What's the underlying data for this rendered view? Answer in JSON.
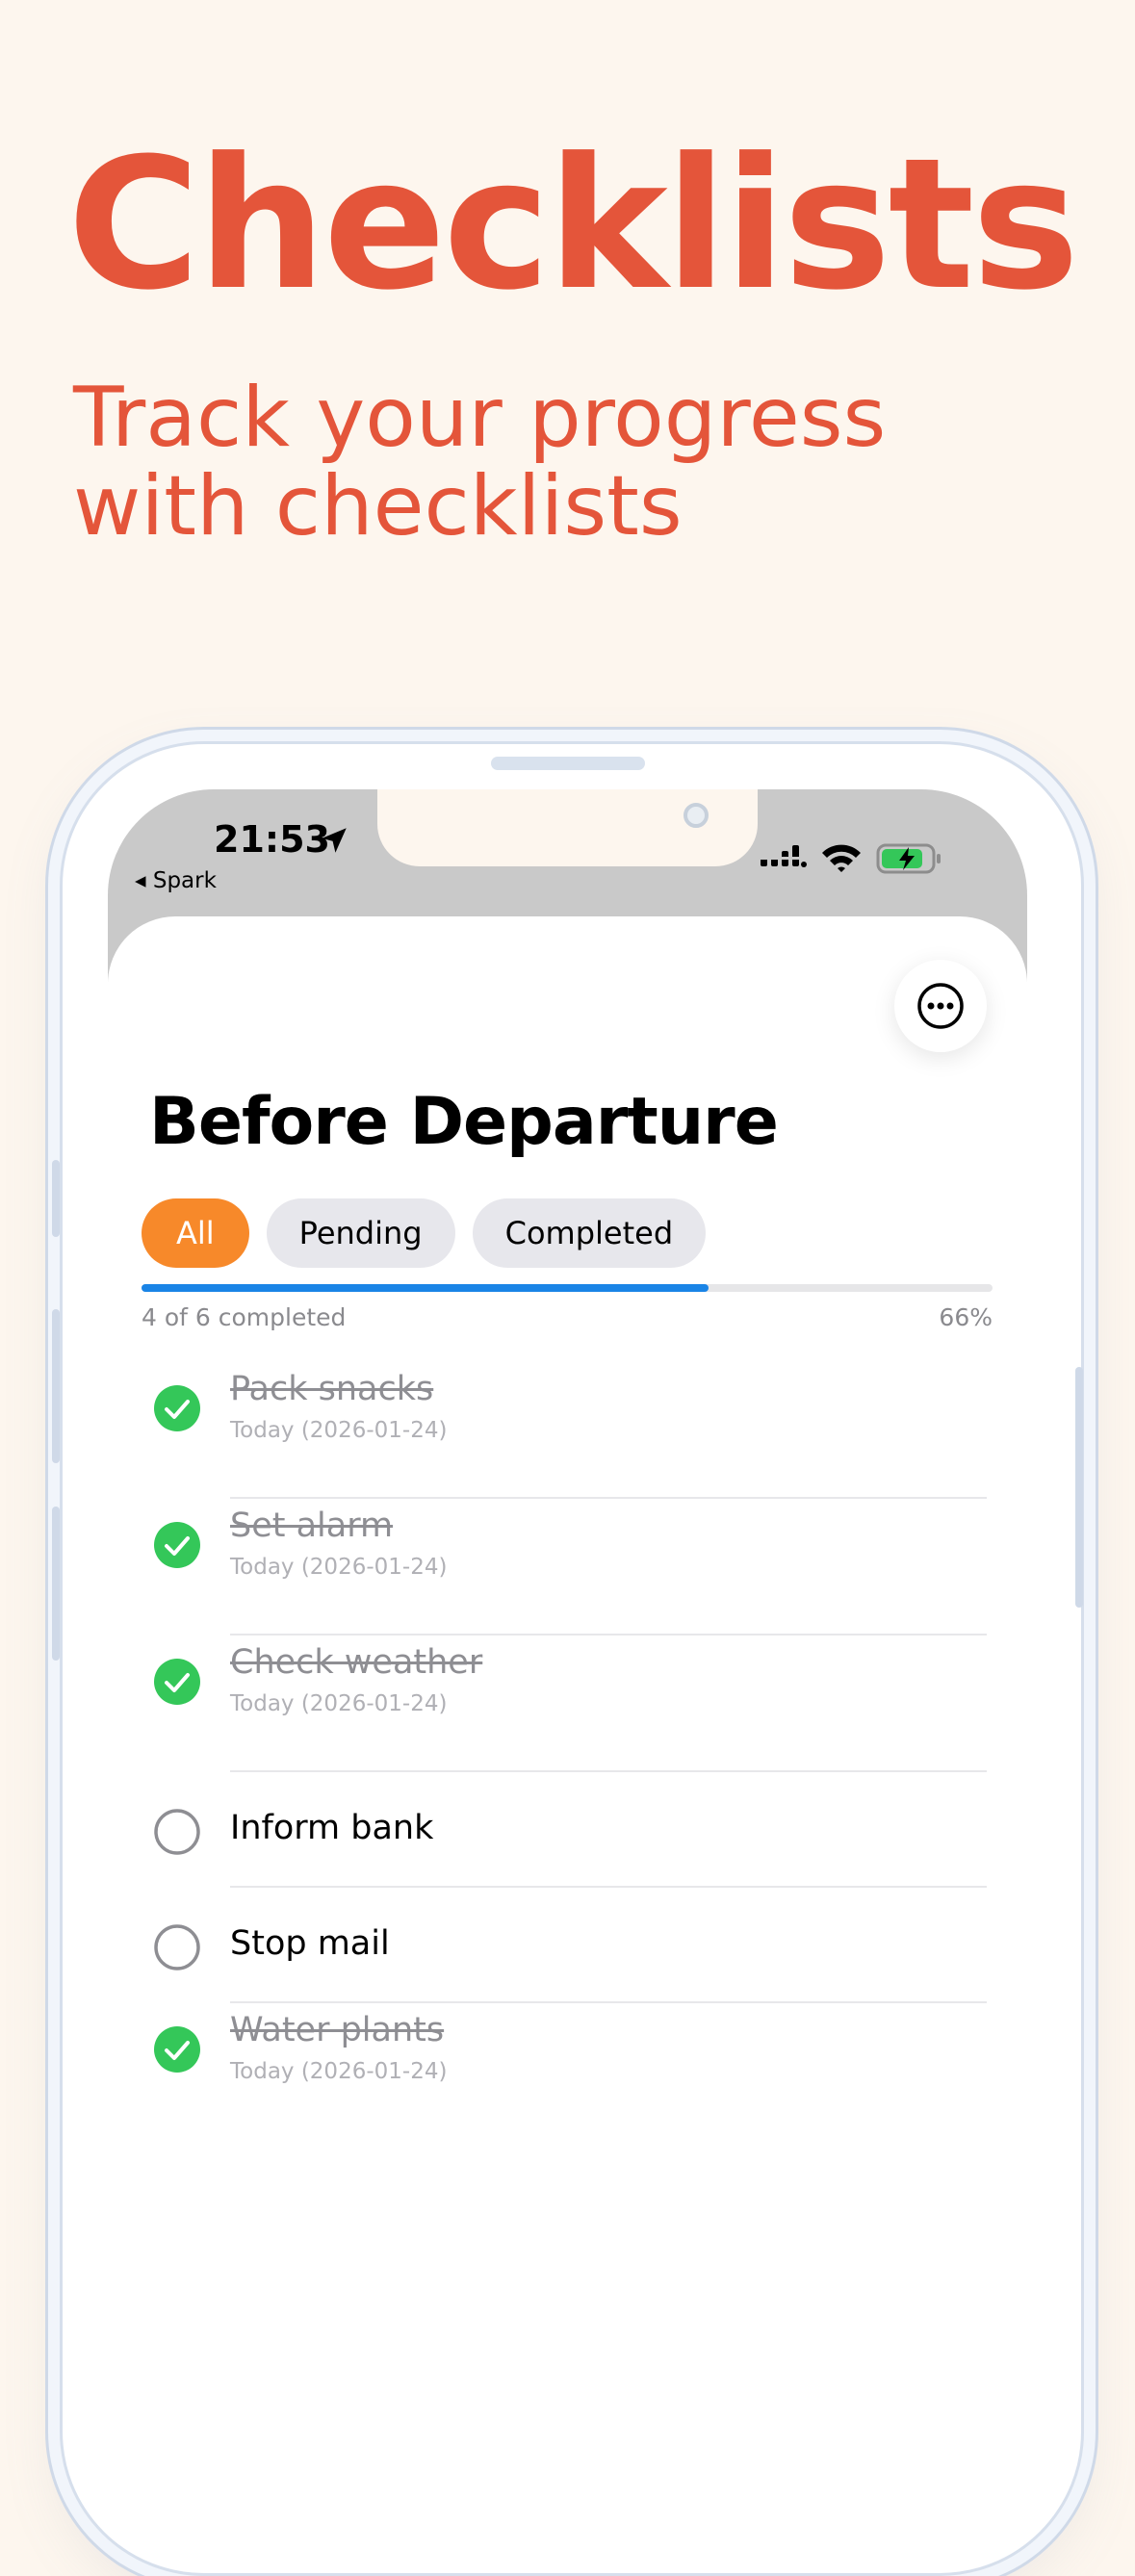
{
  "hero": {
    "title": "Checklists",
    "subtitle": "Track your progress with checklists"
  },
  "status_bar": {
    "time": "21:53",
    "back_label": "◂ Spark",
    "icons": [
      "location-arrow-icon",
      "signal-icon",
      "wifi-icon",
      "battery-charging-icon"
    ]
  },
  "header": {
    "more_icon": "ellipsis-circle-icon",
    "title": "Before Departure"
  },
  "filters": [
    {
      "label": "All",
      "active": true
    },
    {
      "label": "Pending",
      "active": false
    },
    {
      "label": "Completed",
      "active": false
    }
  ],
  "progress": {
    "completed_text": "4 of 6 completed",
    "percent_text": "66%",
    "fraction": 0.666
  },
  "tasks": [
    {
      "name": "Pack snacks",
      "date": "Today (2026-01-24)",
      "done": true
    },
    {
      "name": "Set alarm",
      "date": "Today (2026-01-24)",
      "done": true
    },
    {
      "name": "Check weather",
      "date": "Today (2026-01-24)",
      "done": true
    },
    {
      "name": "Inform bank",
      "date": "",
      "done": false
    },
    {
      "name": "Stop mail",
      "date": "",
      "done": false
    },
    {
      "name": "Water plants",
      "date": "Today (2026-01-24)",
      "done": true
    }
  ],
  "colors": {
    "brand": "#e4553a",
    "background": "#fdf6ee",
    "active_chip": "#f7892a",
    "progress": "#1a84e6",
    "check_done": "#34c759"
  }
}
